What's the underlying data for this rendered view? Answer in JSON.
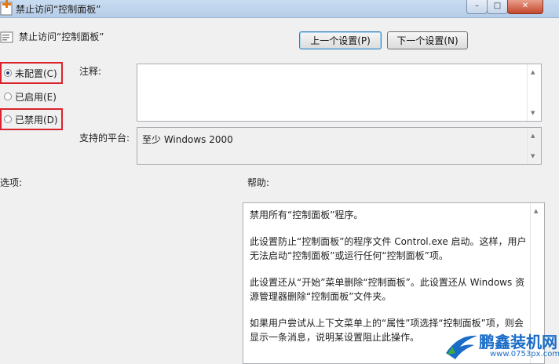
{
  "window": {
    "title": "禁止访问“控制面板”",
    "min_label": "–",
    "max_label": "□",
    "close_label": "✕"
  },
  "header": {
    "policy_name": "禁止访问“控制面板”"
  },
  "nav": {
    "prev_label": "上一个设置(P)",
    "next_label": "下一个设置(N)"
  },
  "state_options": [
    {
      "label": "未配置(C)",
      "checked": true
    },
    {
      "label": "已启用(E)",
      "checked": false
    },
    {
      "label": "已禁用(D)",
      "checked": false
    }
  ],
  "comment": {
    "label": "注释:",
    "value": ""
  },
  "platform": {
    "label": "支持的平台:",
    "value": "至少 Windows 2000"
  },
  "options": {
    "label": "选项:"
  },
  "help": {
    "label": "帮助:",
    "paragraphs": [
      "禁用所有“控制面板”程序。",
      "此设置防止“控制面板”的程序文件 Control.exe 启动。这样，用户无法启动“控制面板”或运行任何“控制面板”项。",
      "此设置还从“开始”菜单删除“控制面板”。此设置还从 Windows 资源管理器删除“控制面板”文件夹。",
      "如果用户尝试从上下文菜单上的“属性”项选择“控制面板”项，则会显示一条消息，说明某设置阻止此操作。"
    ]
  },
  "watermark": {
    "name": "鹏鑫装机网",
    "url": "www.0753px.com"
  },
  "colors": {
    "highlight_box": "#d9242c",
    "title_bar": "#c9dcf1",
    "logo": "#1a6cc7"
  }
}
